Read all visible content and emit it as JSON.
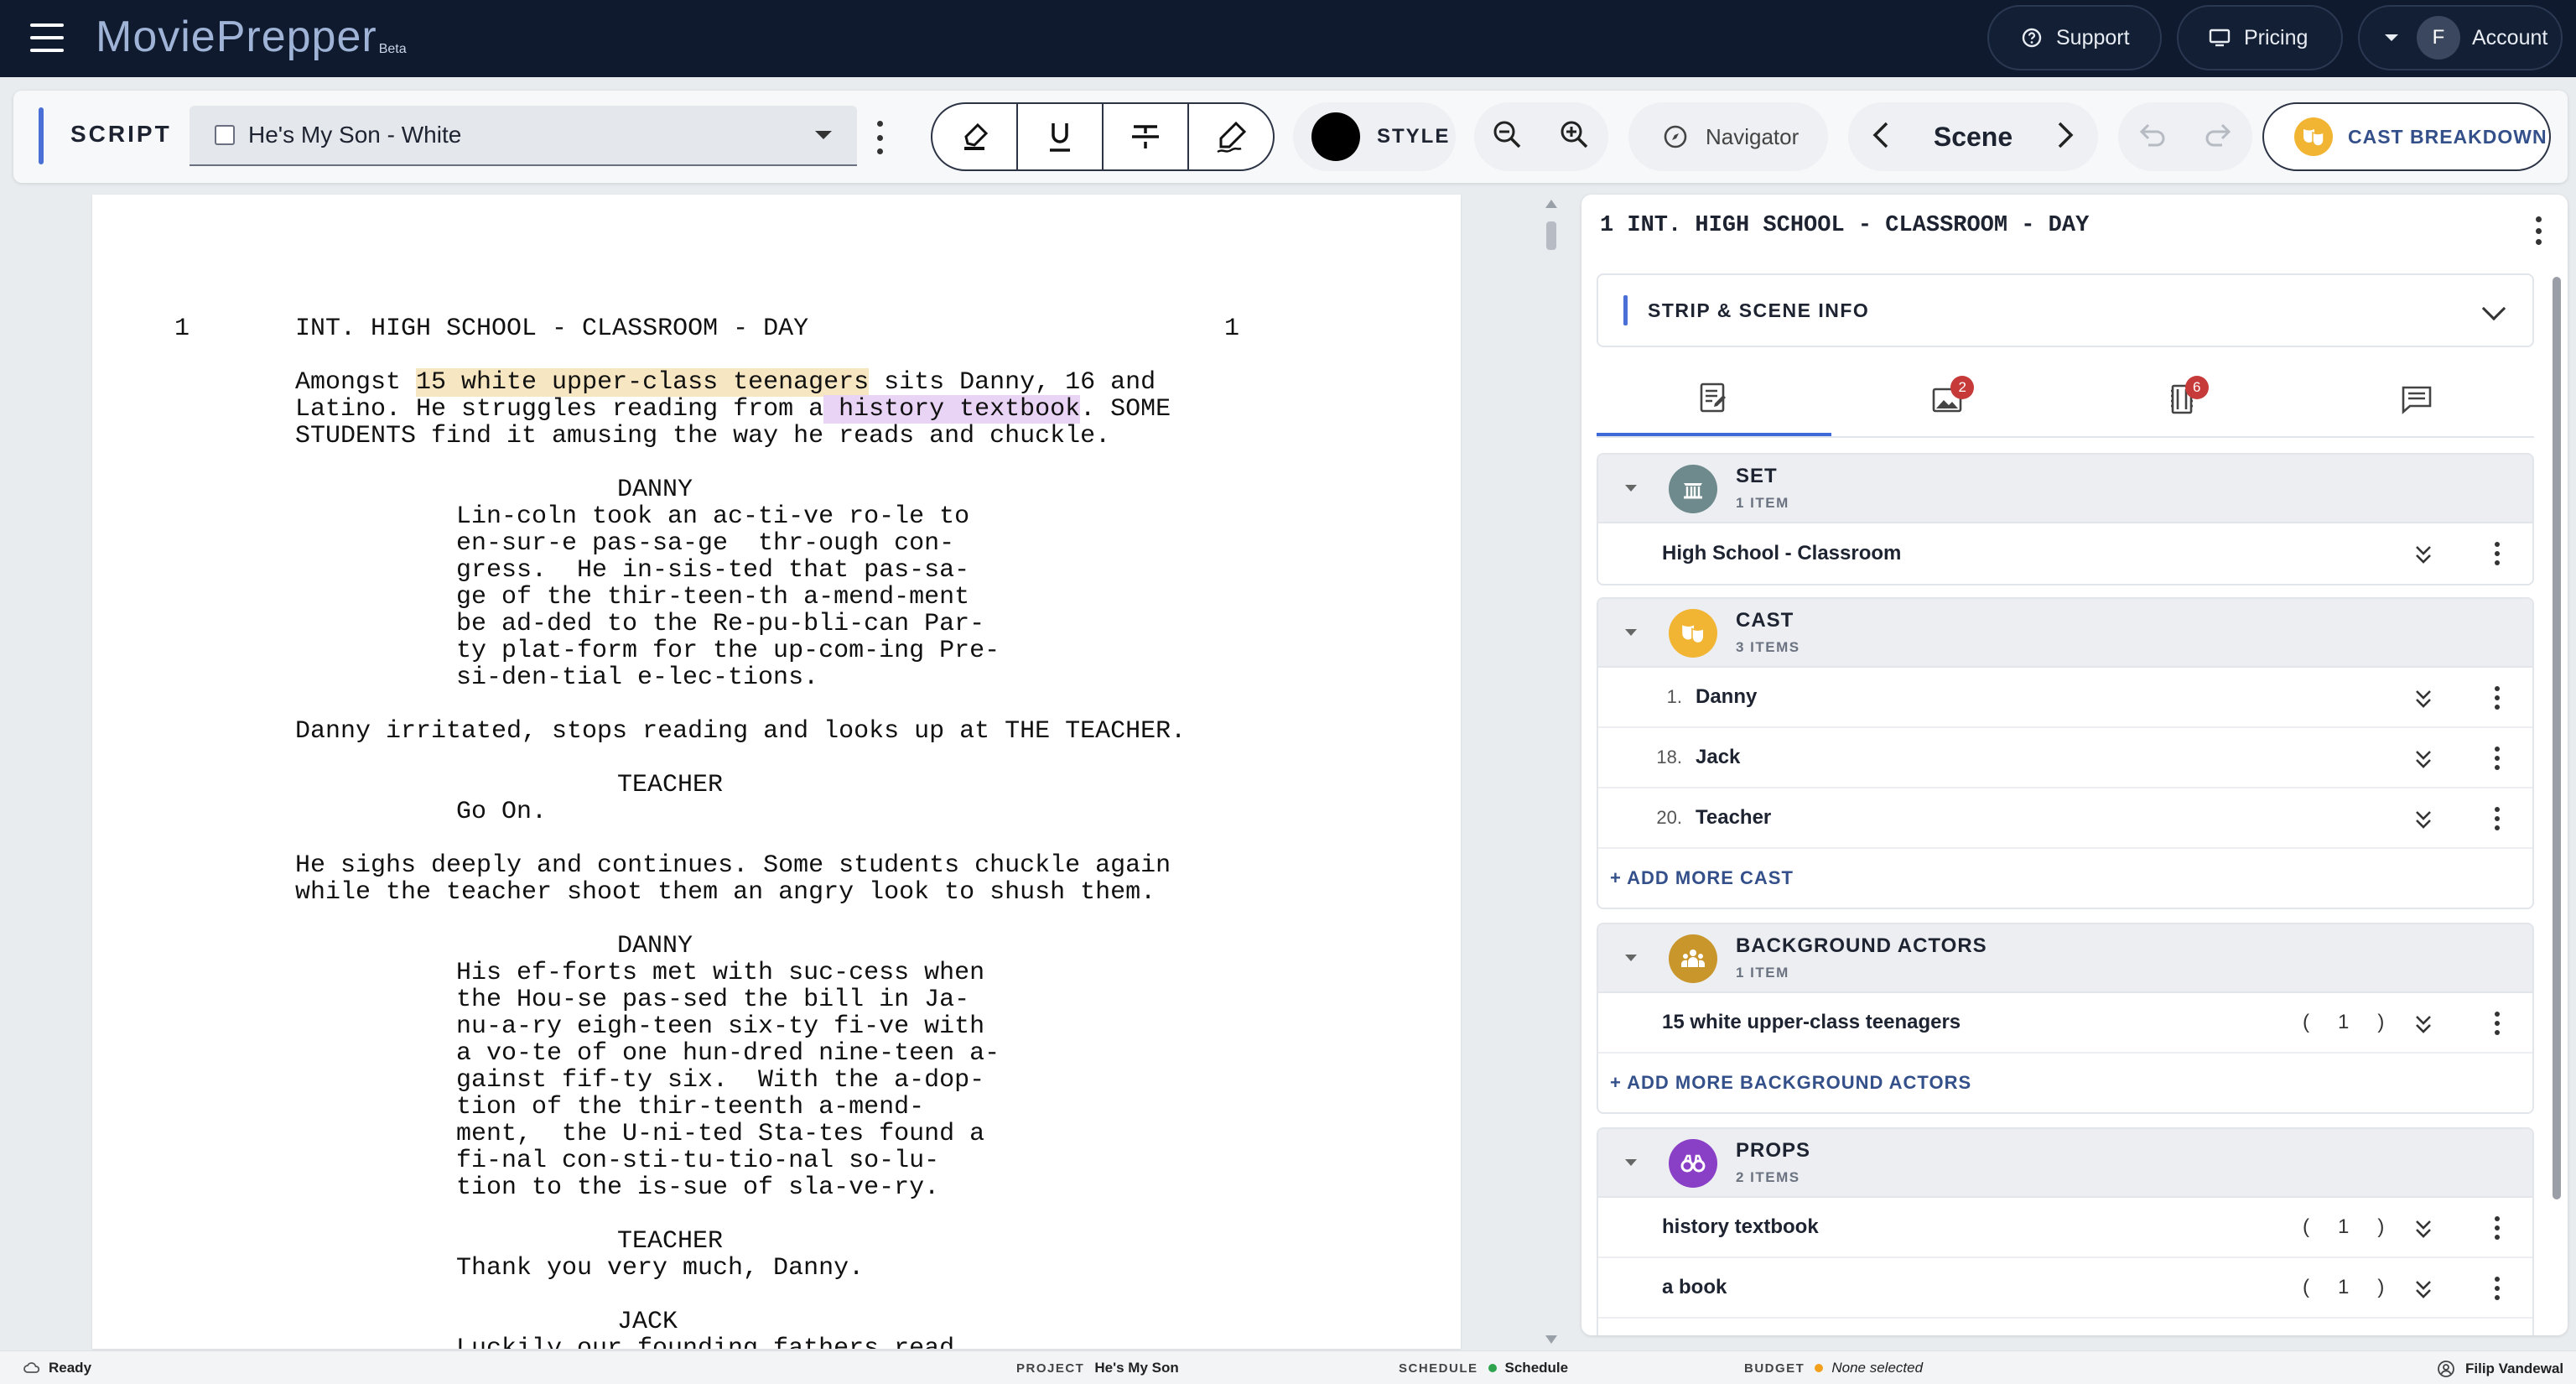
{
  "app": {
    "logo": "MoviePrepper",
    "logo_badge": "Beta",
    "support_label": "Support",
    "pricing_label": "Pricing",
    "account_initial": "F",
    "account_label": "Account"
  },
  "toolbar": {
    "section_label": "SCRIPT",
    "script_name": "He's My Son - White",
    "style_label": "STYLE",
    "navigator_label": "Navigator",
    "scene_label": "Scene",
    "cast_breakdown_label": "CAST BREAKDOWN"
  },
  "script": {
    "scene_number": "1",
    "scene_number_right": "1",
    "heading": "INT. HIGH SCHOOL - CLASSROOM - DAY",
    "action1_a": "Amongst ",
    "action1_hl": "15 white upper-class teenagers",
    "action1_b": " sits Danny, 16 and",
    "action2_a": "Latino. He struggles reading from a",
    "action2_hl": " history textbook",
    "action2_b": ". SOME",
    "action3": "STUDENTS find it amusing the way he reads and chuckle.",
    "char1": "DANNY",
    "dlg1": [
      "Lin-coln took an ac-ti-ve ro-le to",
      "en-sur-e pas-sa-ge  thr-ough con-",
      "gress.  He in-sis-ted that pas-sa-",
      "ge of the thir-teen-th a-mend-ment",
      "be ad-ded to the Re-pu-bli-can Par-",
      "ty plat-form for the up-com-ing Pre-",
      "si-den-tial e-lec-tions."
    ],
    "action4": "Danny irritated, stops reading and looks up at THE TEACHER.",
    "char2": "TEACHER",
    "dlg2": "Go On.",
    "action5": [
      "He sighs deeply and continues. Some students chuckle again",
      "while the teacher shoot them an angry look to shush them."
    ],
    "char3": "DANNY",
    "dlg3": [
      "His ef-forts met with suc-cess when",
      "the Hou-se pas-sed the bill in Ja-",
      "nu-a-ry eigh-teen six-ty fi-ve with",
      "a vo-te of one hun-dred nine-teen a-",
      "gainst fif-ty six.  With the a-dop-",
      "tion of the thir-teenth a-mend-",
      "ment,  the U-ni-ted Sta-tes found a",
      "fi-nal con-sti-tu-tio-nal so-lu-",
      "tion to the is-sue of sla-ve-ry."
    ],
    "char4": "TEACHER",
    "dlg4": "Thank you very much, Danny.",
    "char5": "JACK",
    "dlg5": "Luckily our founding fathers read"
  },
  "panel": {
    "title": "1 INT. HIGH SCHOOL - CLASSROOM - DAY",
    "strip_label": "STRIP & SCENE INFO",
    "tab_badges": [
      "2",
      "6"
    ],
    "sections": {
      "set": {
        "title": "SET",
        "count": "1 ITEM",
        "items": [
          "High School - Classroom"
        ]
      },
      "cast": {
        "title": "CAST",
        "count": "3 ITEMS",
        "items": [
          {
            "num": "1.",
            "name": "Danny"
          },
          {
            "num": "18.",
            "name": "Jack"
          },
          {
            "num": "20.",
            "name": "Teacher"
          }
        ],
        "add_label": "+ ADD MORE CAST"
      },
      "background": {
        "title": "BACKGROUND ACTORS",
        "count": "1 ITEM",
        "items": [
          {
            "name": "15 white upper-class teenagers",
            "qty": "1"
          }
        ],
        "add_label": "+ ADD MORE BACKGROUND ACTORS"
      },
      "props": {
        "title": "PROPS",
        "count": "2 ITEMS",
        "items": [
          {
            "name": "history textbook",
            "qty": "1"
          },
          {
            "name": "a book",
            "qty": "1"
          }
        ]
      }
    },
    "paren_open": "(",
    "paren_close": ")"
  },
  "status": {
    "ready": "Ready",
    "project_label": "PROJECT",
    "project_value": "He's My Son",
    "schedule_label": "SCHEDULE",
    "schedule_value": "Schedule",
    "budget_label": "BUDGET",
    "budget_value": "None selected",
    "user": "Filip Vandewal"
  },
  "colors": {
    "nav_bg": "#0f1a2e",
    "accent": "#4a6fd6",
    "bg_highlight": "#f6e6c2",
    "prop_highlight": "#ead4f5",
    "set_icon": "#6f8a8c",
    "cast_icon": "#f2b533",
    "background_icon": "#c9962b",
    "props_icon": "#8a3fc7",
    "badge": "#c63a3a"
  }
}
